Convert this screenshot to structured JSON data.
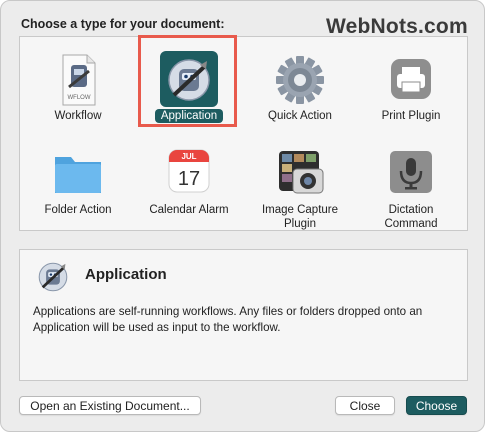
{
  "dialog": {
    "header": "Choose a type for your document:",
    "watermark": "WebNots.com"
  },
  "tiles": [
    {
      "label": "Workflow",
      "icon": "workflow-document-icon",
      "badge": "WFLOW"
    },
    {
      "label": "Application",
      "icon": "automator-robot-icon",
      "selected": true
    },
    {
      "label": "Quick Action",
      "icon": "gear-icon"
    },
    {
      "label": "Print Plugin",
      "icon": "printer-icon"
    },
    {
      "label": "Folder Action",
      "icon": "folder-icon"
    },
    {
      "label": "Calendar Alarm",
      "icon": "calendar-icon",
      "month": "JUL",
      "day": "17"
    },
    {
      "label": "Image Capture\nPlugin",
      "icon": "image-capture-icon"
    },
    {
      "label": "Dictation\nCommand",
      "icon": "microphone-icon"
    }
  ],
  "description": {
    "title": "Application",
    "text": "Applications are self-running workflows. Any files or folders dropped onto an Application will be used as input to the workflow."
  },
  "buttons": {
    "open_existing": "Open an Existing Document...",
    "close": "Close",
    "choose": "Choose"
  },
  "colors": {
    "accent": "#1d5c60",
    "highlight_outline": "#e85a4c"
  }
}
